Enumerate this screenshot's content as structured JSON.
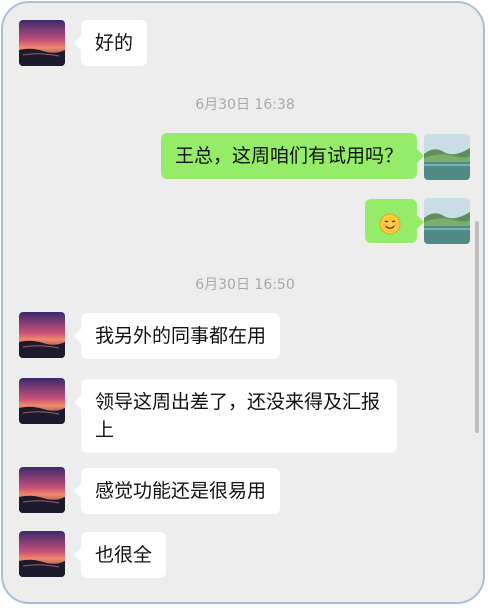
{
  "chat": {
    "messages": [
      {
        "sender": "other",
        "text": "好的"
      },
      {
        "type": "timestamp",
        "text": "6月30日 16:38"
      },
      {
        "sender": "me",
        "text": "王总，这周咱们有试用吗？"
      },
      {
        "sender": "me",
        "emoji": "smiling-face-emoji"
      },
      {
        "type": "timestamp",
        "text": "6月30日 16:50"
      },
      {
        "sender": "other",
        "text": "我另外的同事都在用"
      },
      {
        "sender": "other",
        "text": "领导这周出差了，还没来得及汇报上"
      },
      {
        "sender": "other",
        "text": "感觉功能还是很易用"
      },
      {
        "sender": "other",
        "text": "也很全"
      }
    ]
  },
  "colors": {
    "chat_background": "#ededed",
    "my_bubble": "#95ec69",
    "their_bubble": "#ffffff",
    "timestamp_text": "#a8a8a8",
    "frame_border": "#a9bfd8"
  }
}
